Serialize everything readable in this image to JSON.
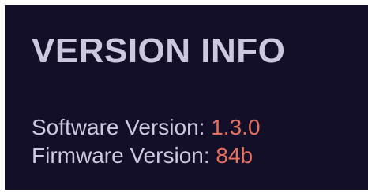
{
  "panel": {
    "title": "VERSION INFO",
    "rows": [
      {
        "label": "Software Version:",
        "value": "1.3.0"
      },
      {
        "label": "Firmware Version:",
        "value": "84b"
      }
    ]
  },
  "colors": {
    "background": "#130f28",
    "text": "#ccc8e0",
    "accent": "#e8705c"
  }
}
